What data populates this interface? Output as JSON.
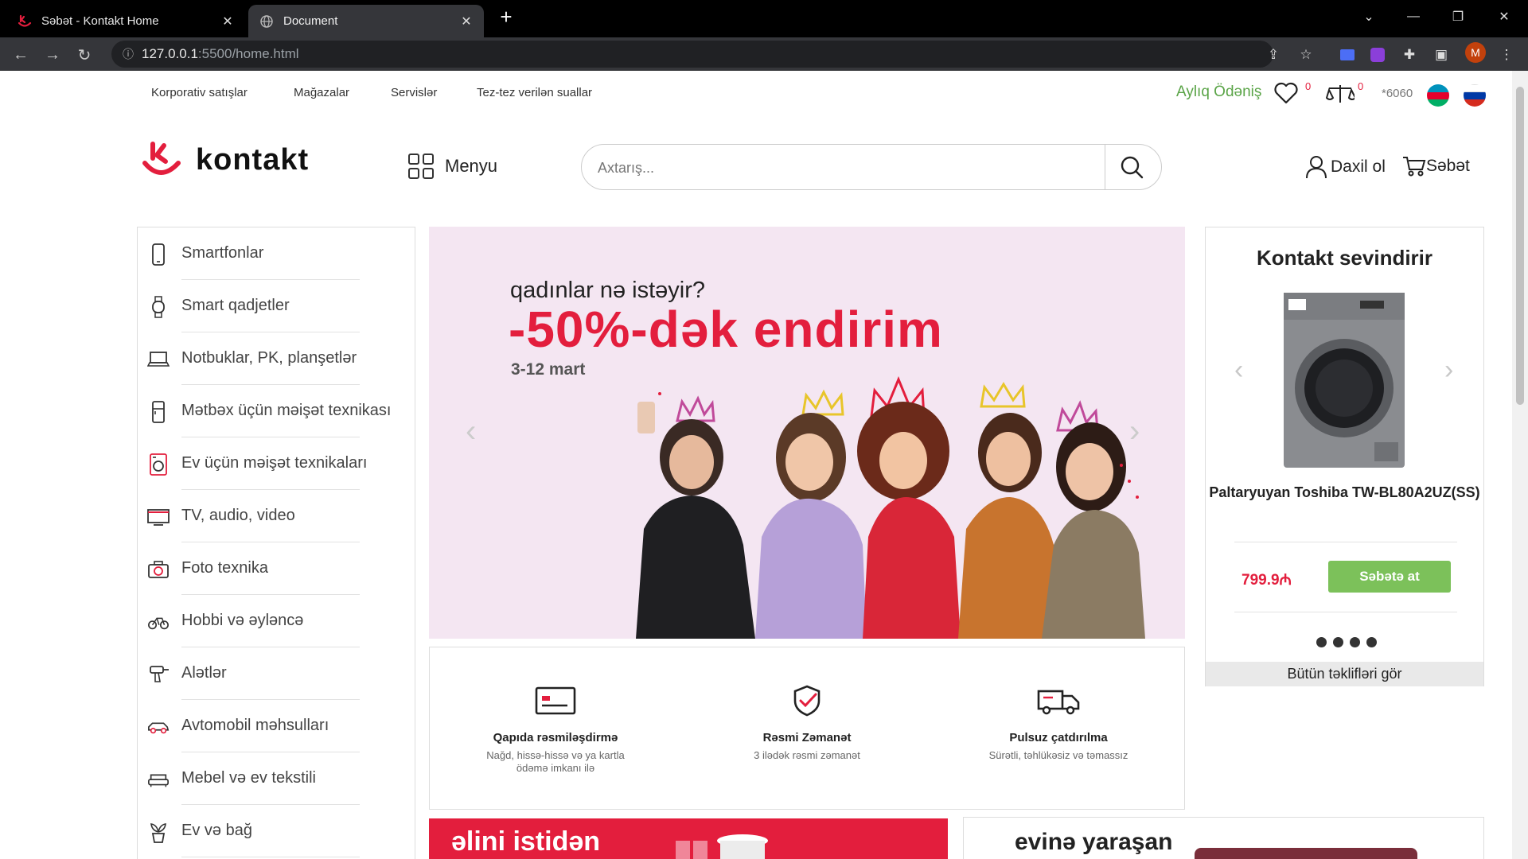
{
  "browser": {
    "tabs": [
      {
        "title": "Səbət - Kontakt Home",
        "active": false
      },
      {
        "title": "Document",
        "active": true
      }
    ],
    "url_host": "127.0.0.1",
    "url_path": ":5500/home.html",
    "profile_initial": "M"
  },
  "topnav": {
    "links": [
      "Korporativ satışlar",
      "Mağazalar",
      "Servislər",
      "Tez-tez verilən suallar"
    ],
    "monthly_payment": "Aylıq Ödəniş",
    "wishlist_count": "0",
    "compare_count": "0",
    "phone": "*6060"
  },
  "header": {
    "logo_text": "kontakt",
    "menu_label": "Menyu",
    "search_placeholder": "Axtarış...",
    "login_label": "Daxil ol",
    "cart_label": "Səbət"
  },
  "categories": [
    {
      "label": "Smartfonlar",
      "icon": "smartphone-icon"
    },
    {
      "label": "Smart qadjetler",
      "icon": "smartwatch-icon"
    },
    {
      "label": "Notbuklar, PK, planşetlər",
      "icon": "laptop-icon"
    },
    {
      "label": "Mətbəx üçün məişət texnikası",
      "icon": "fridge-icon"
    },
    {
      "label": "Ev üçün məişət texnikaları",
      "icon": "washer-icon"
    },
    {
      "label": "TV, audio, video",
      "icon": "tv-icon"
    },
    {
      "label": "Foto texnika",
      "icon": "camera-icon"
    },
    {
      "label": "Hobbi və əyləncə",
      "icon": "bike-icon"
    },
    {
      "label": "Alətlər",
      "icon": "drill-icon"
    },
    {
      "label": "Avtomobil məhsulları",
      "icon": "car-icon"
    },
    {
      "label": "Mebel və ev tekstili",
      "icon": "sofa-icon"
    },
    {
      "label": "Ev və bağ",
      "icon": "plant-icon"
    }
  ],
  "banner": {
    "line1": "qadınlar nə istəyir?",
    "line2": "-50%-dək endirim",
    "line3": "3-12 mart"
  },
  "features": [
    {
      "title": "Qapıda rəsmiləşdirmə",
      "desc": "Nağd, hissə-hissə və ya kartla ödəmə imkanı ilə",
      "icon": "card-icon"
    },
    {
      "title": "Rəsmi Zəmanət",
      "desc": "3 ilədək rəsmi zəmanət",
      "icon": "shield-check-icon"
    },
    {
      "title": "Pulsuz çatdırılma",
      "desc": "Sürətli, təhlükəsiz və təmassız",
      "icon": "truck-icon"
    }
  ],
  "promo": {
    "title": "Kontakt sevindirir",
    "product_name": "Paltaryuyan Toshiba TW-BL80A2UZ(SS)",
    "price": "799.9₼",
    "add_to_cart": "Səbətə at",
    "see_all": "Bütün təklifləri gör"
  },
  "bottom_banners": {
    "left": "əlini istidən",
    "right": "evinə yaraşan"
  },
  "colors": {
    "brand_red": "#e31e3d",
    "green": "#7cc15a",
    "banner_bg": "#f4e6f2"
  }
}
